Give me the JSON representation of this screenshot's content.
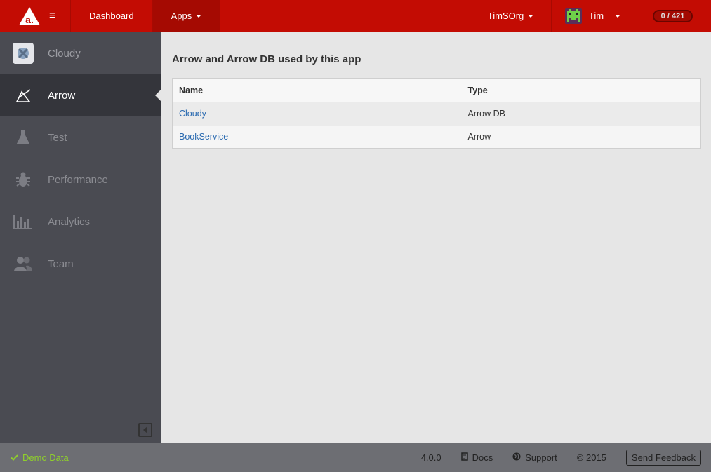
{
  "topbar": {
    "nav": {
      "dashboard": "Dashboard",
      "apps": "Apps"
    },
    "org": "TimSOrg",
    "user": "Tim",
    "credits": "0 / 421",
    "brand_color": "#c30c03"
  },
  "sidebar": {
    "items": [
      {
        "label": "Cloudy",
        "icon": "app-icon"
      },
      {
        "label": "Arrow",
        "icon": "arrow-icon"
      },
      {
        "label": "Test",
        "icon": "flask-icon"
      },
      {
        "label": "Performance",
        "icon": "bug-icon"
      },
      {
        "label": "Analytics",
        "icon": "bar-chart-icon"
      },
      {
        "label": "Team",
        "icon": "team-icon"
      }
    ],
    "active": "Arrow"
  },
  "main": {
    "title": "Arrow and Arrow DB used by this app",
    "columns": [
      "Name",
      "Type"
    ],
    "rows": [
      {
        "name": "Cloudy",
        "type": "Arrow DB"
      },
      {
        "name": "BookService",
        "type": "Arrow"
      }
    ]
  },
  "footer": {
    "demo": "Demo Data",
    "version": "4.0.0",
    "docs": "Docs",
    "support": "Support",
    "copyright": "© 2015",
    "feedback": "Send Feedback"
  }
}
